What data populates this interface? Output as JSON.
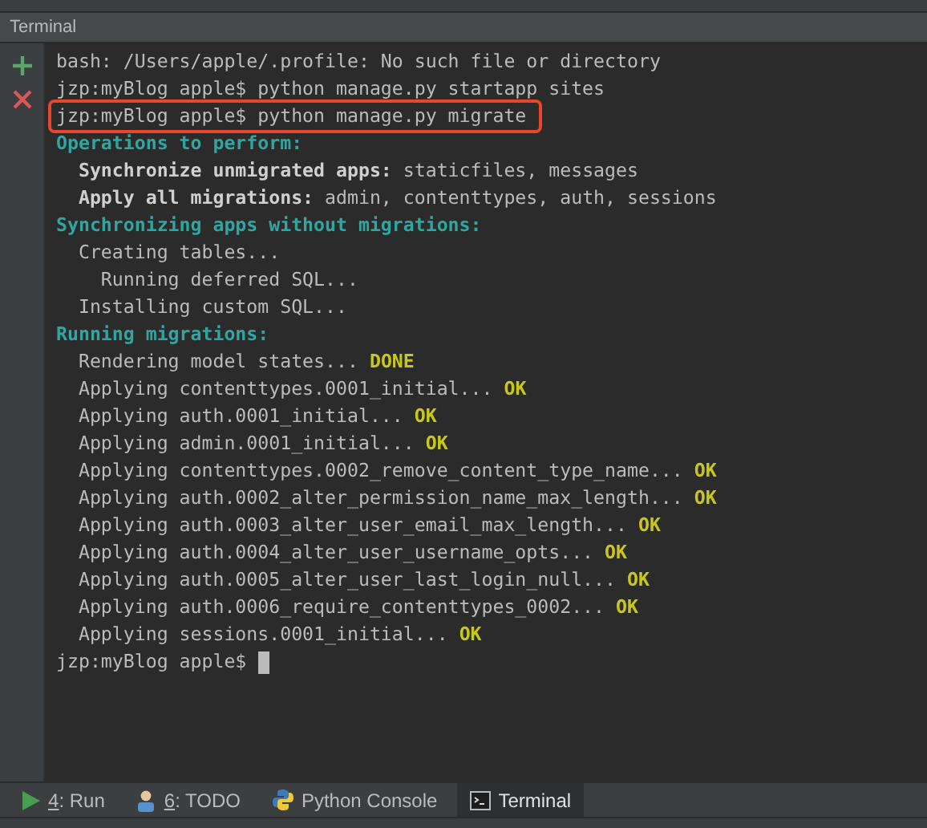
{
  "panel": {
    "title": "Terminal"
  },
  "terminal": {
    "lines": [
      {
        "highlighted": false,
        "segments": [
          {
            "kind": "plain",
            "text": "bash: /Users/apple/.profile: No such file or directory"
          }
        ]
      },
      {
        "highlighted": false,
        "segments": [
          {
            "kind": "plain",
            "text": "jzp:myBlog apple$ python manage.py startapp sites"
          }
        ]
      },
      {
        "highlighted": true,
        "segments": [
          {
            "kind": "plain",
            "text": "jzp:myBlog apple$ python manage.py migrate"
          }
        ]
      },
      {
        "highlighted": false,
        "segments": [
          {
            "kind": "heading",
            "text": "Operations to perform:"
          }
        ]
      },
      {
        "highlighted": false,
        "segments": [
          {
            "kind": "bold",
            "text": "  Synchronize unmigrated apps:"
          },
          {
            "kind": "plain",
            "text": " staticfiles, messages"
          }
        ]
      },
      {
        "highlighted": false,
        "segments": [
          {
            "kind": "bold",
            "text": "  Apply all migrations:"
          },
          {
            "kind": "plain",
            "text": " admin, contenttypes, auth, sessions"
          }
        ]
      },
      {
        "highlighted": false,
        "segments": [
          {
            "kind": "heading",
            "text": "Synchronizing apps without migrations:"
          }
        ]
      },
      {
        "highlighted": false,
        "segments": [
          {
            "kind": "plain",
            "text": "  Creating tables..."
          }
        ]
      },
      {
        "highlighted": false,
        "segments": [
          {
            "kind": "plain",
            "text": "    Running deferred SQL..."
          }
        ]
      },
      {
        "highlighted": false,
        "segments": [
          {
            "kind": "plain",
            "text": "  Installing custom SQL..."
          }
        ]
      },
      {
        "highlighted": false,
        "segments": [
          {
            "kind": "heading",
            "text": "Running migrations:"
          }
        ]
      },
      {
        "highlighted": false,
        "segments": [
          {
            "kind": "plain",
            "text": "  Rendering model states..."
          },
          {
            "kind": "status",
            "text": "DONE"
          }
        ]
      },
      {
        "highlighted": false,
        "segments": [
          {
            "kind": "plain",
            "text": "  Applying contenttypes.0001_initial..."
          },
          {
            "kind": "status",
            "text": "OK"
          }
        ]
      },
      {
        "highlighted": false,
        "segments": [
          {
            "kind": "plain",
            "text": "  Applying auth.0001_initial..."
          },
          {
            "kind": "status",
            "text": "OK"
          }
        ]
      },
      {
        "highlighted": false,
        "segments": [
          {
            "kind": "plain",
            "text": "  Applying admin.0001_initial..."
          },
          {
            "kind": "status",
            "text": "OK"
          }
        ]
      },
      {
        "highlighted": false,
        "segments": [
          {
            "kind": "plain",
            "text": "  Applying contenttypes.0002_remove_content_type_name..."
          },
          {
            "kind": "status",
            "text": "OK"
          }
        ]
      },
      {
        "highlighted": false,
        "segments": [
          {
            "kind": "plain",
            "text": "  Applying auth.0002_alter_permission_name_max_length..."
          },
          {
            "kind": "status",
            "text": "OK"
          }
        ]
      },
      {
        "highlighted": false,
        "segments": [
          {
            "kind": "plain",
            "text": "  Applying auth.0003_alter_user_email_max_length..."
          },
          {
            "kind": "status",
            "text": "OK"
          }
        ]
      },
      {
        "highlighted": false,
        "segments": [
          {
            "kind": "plain",
            "text": "  Applying auth.0004_alter_user_username_opts..."
          },
          {
            "kind": "status",
            "text": "OK"
          }
        ]
      },
      {
        "highlighted": false,
        "segments": [
          {
            "kind": "plain",
            "text": "  Applying auth.0005_alter_user_last_login_null..."
          },
          {
            "kind": "status",
            "text": "OK"
          }
        ]
      },
      {
        "highlighted": false,
        "segments": [
          {
            "kind": "plain",
            "text": "  Applying auth.0006_require_contenttypes_0002..."
          },
          {
            "kind": "status",
            "text": "OK"
          }
        ]
      },
      {
        "highlighted": false,
        "segments": [
          {
            "kind": "plain",
            "text": "  Applying sessions.0001_initial..."
          },
          {
            "kind": "status",
            "text": "OK"
          }
        ]
      },
      {
        "highlighted": false,
        "cursor": true,
        "segments": [
          {
            "kind": "plain",
            "text": "jzp:myBlog apple$"
          }
        ]
      }
    ]
  },
  "tool_tabs": [
    {
      "kind": "run",
      "key": "4",
      "label": ": Run",
      "selected": false
    },
    {
      "kind": "todo",
      "key": "6",
      "label": ": TODO",
      "selected": false
    },
    {
      "kind": "python",
      "label": "Python Console",
      "selected": false
    },
    {
      "kind": "terminal",
      "label": "Terminal",
      "selected": true
    }
  ]
}
